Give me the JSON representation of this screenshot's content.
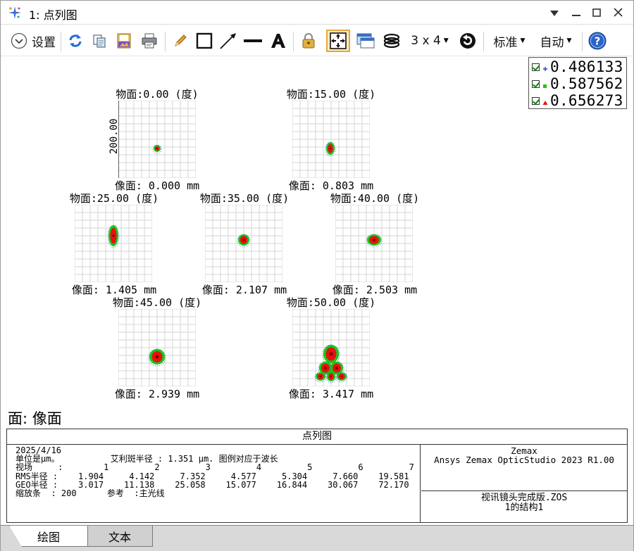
{
  "window": {
    "title": "1: 点列图",
    "icon": "sparkle-icon"
  },
  "toolbar": {
    "settings_label": "设置",
    "layout_label": "3 x 4",
    "standard_label": "标准",
    "auto_label": "自动",
    "icons": [
      "settings-chevron-icon",
      "refresh-icon",
      "copy-icon",
      "save-icon",
      "print-icon",
      "pencil-icon",
      "rectangle-icon",
      "arrow-icon",
      "line-icon",
      "text-icon",
      "lock-icon",
      "fit-icon",
      "window-icon",
      "layers-icon",
      "rotate-icon",
      "help-icon"
    ]
  },
  "legend": {
    "items": [
      {
        "value": "0.486133",
        "color": "#1f3fd8",
        "marker": "plus"
      },
      {
        "value": "0.587562",
        "color": "#15c915",
        "marker": "square"
      },
      {
        "value": "0.656273",
        "color": "#e81010",
        "marker": "triangle"
      }
    ]
  },
  "scale_label": "200.00",
  "fields": [
    {
      "title": "物面:0.00 (度)",
      "image": "像面: 0.000 mm"
    },
    {
      "title": "物面:15.00 (度)",
      "image": "像面: 0.803 mm"
    },
    {
      "title": "物面:25.00 (度)",
      "image": "像面: 1.405 mm"
    },
    {
      "title": "物面:35.00 (度)",
      "image": "像面: 2.107 mm"
    },
    {
      "title": "物面:40.00 (度)",
      "image": "像面: 2.503 mm"
    },
    {
      "title": "物面:45.00 (度)",
      "image": "像面: 2.939 mm"
    },
    {
      "title": "物面:50.00 (度)",
      "image": "像面: 3.417 mm"
    }
  ],
  "surface_label": "面: 像面",
  "info": {
    "heading": "点列图",
    "date": "2025/4/16",
    "unit_line": "单位是µm。          艾利斑半径 : 1.351 µm. 图例对应于波长",
    "field_line": "视场     :        1         2         3         4         5         6         7",
    "rms_line": "RMS半径 :    1.904     4.142     7.352     4.577     5.304     7.660    19.581",
    "geo_line": "GEO半径 :    3.017    11.138    25.058    15.077    16.844    30.067    72.170",
    "scale_line": "缩放条  : 200      参考  :主光线",
    "vendor": "Zemax",
    "product": "Ansys Zemax OpticStudio 2023 R1.00",
    "file": "视讯镜头完成版.ZOS",
    "config": "1的结构1"
  },
  "tabs": {
    "plot": "绘图",
    "text": "文本"
  }
}
